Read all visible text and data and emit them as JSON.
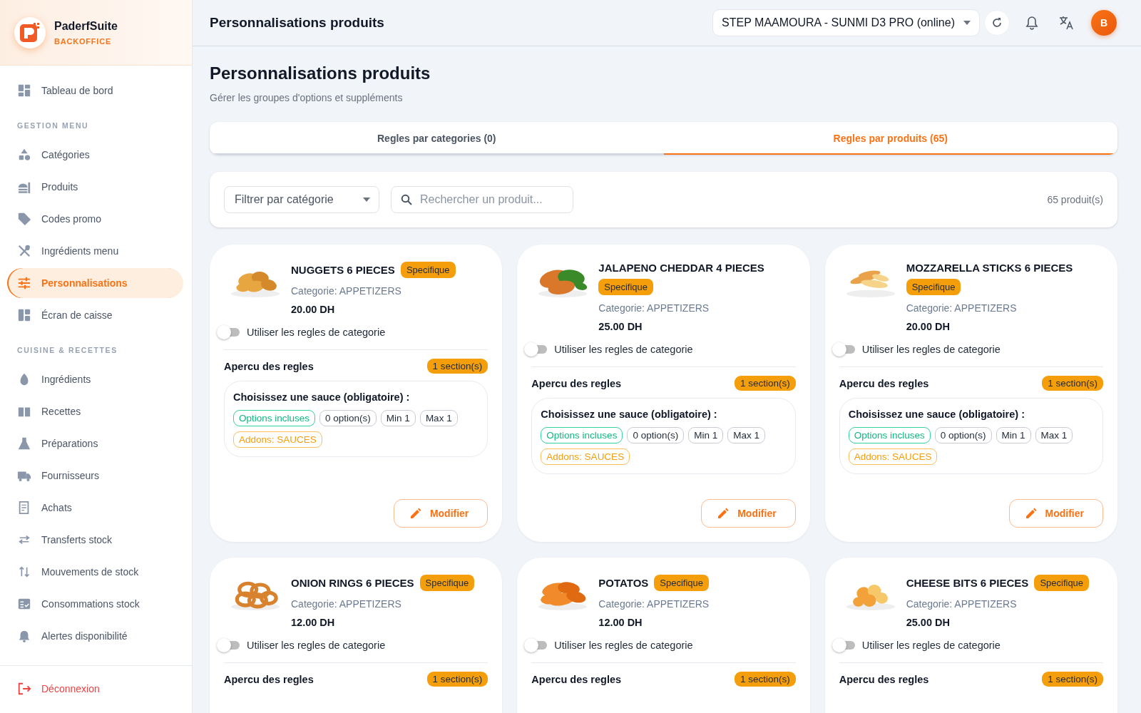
{
  "sidebar": {
    "brand": "PaderfSuite",
    "subtitle": "BACKOFFICE",
    "top_items": [
      {
        "label": "Tableau de bord",
        "selected": false
      }
    ],
    "sections": [
      {
        "title": "GESTION MENU",
        "items": [
          {
            "label": "Catégories",
            "selected": false
          },
          {
            "label": "Produits",
            "selected": false
          },
          {
            "label": "Codes promo",
            "selected": false
          },
          {
            "label": "Ingrédients menu",
            "selected": false
          },
          {
            "label": "Personnalisations",
            "selected": true
          },
          {
            "label": "Écran de caisse",
            "selected": false
          }
        ]
      },
      {
        "title": "CUISINE & RECETTES",
        "items": [
          {
            "label": "Ingrédients",
            "selected": false
          },
          {
            "label": "Recettes",
            "selected": false
          },
          {
            "label": "Préparations",
            "selected": false
          },
          {
            "label": "Fournisseurs",
            "selected": false
          },
          {
            "label": "Achats",
            "selected": false
          },
          {
            "label": "Transferts stock",
            "selected": false
          },
          {
            "label": "Mouvements de stock",
            "selected": false
          },
          {
            "label": "Consommations stock",
            "selected": false
          },
          {
            "label": "Alertes disponibilité",
            "selected": false
          }
        ]
      }
    ],
    "logout": "Déconnexion"
  },
  "header": {
    "title": "Personnalisations produits",
    "device": "STEP MAAMOURA - SUNMI D3 PRO (online)",
    "avatar": "B"
  },
  "page": {
    "title": "Personnalisations produits",
    "subtitle": "Gérer les groupes d'options et suppléments"
  },
  "tabs": [
    {
      "label": "Regles par categories (0)",
      "selected": false
    },
    {
      "label": "Regles par produits (65)",
      "selected": true
    }
  ],
  "filters": {
    "category": "Filtrer par catégorie",
    "search_placeholder": "Rechercher un produit...",
    "count": "65 produit(s)"
  },
  "products": [
    {
      "name": "NUGGETS 6 PIECES",
      "badge": "Specifique",
      "category": "Categorie: APPETIZERS",
      "price": "20.00 DH",
      "toggle_label": "Utiliser les regles de categorie",
      "use_category_rules": false,
      "rules_title": "Apercu des regles",
      "sections_count": "1 section(s)",
      "sections": [
        {
          "title": "Choisissez une sauce (obligatoire) :",
          "tags": [
            {
              "text": "Options incluses",
              "kind": "success"
            },
            {
              "text": "0 option(s)",
              "kind": "neutral"
            },
            {
              "text": "Min 1",
              "kind": "neutral"
            },
            {
              "text": "Max 1",
              "kind": "neutral"
            },
            {
              "text": "Addons: SAUCES",
              "kind": "warning"
            }
          ]
        }
      ],
      "edit": "Modifier"
    },
    {
      "name": "JALAPENO CHEDDAR 4 PIECES",
      "badge": "Specifique",
      "category": "Categorie: APPETIZERS",
      "price": "25.00 DH",
      "toggle_label": "Utiliser les regles de categorie",
      "use_category_rules": false,
      "rules_title": "Apercu des regles",
      "sections_count": "1 section(s)",
      "sections": [
        {
          "title": "Choisissez une sauce (obligatoire) :",
          "tags": [
            {
              "text": "Options incluses",
              "kind": "success"
            },
            {
              "text": "0 option(s)",
              "kind": "neutral"
            },
            {
              "text": "Min 1",
              "kind": "neutral"
            },
            {
              "text": "Max 1",
              "kind": "neutral"
            },
            {
              "text": "Addons: SAUCES",
              "kind": "warning"
            }
          ]
        }
      ],
      "edit": "Modifier"
    },
    {
      "name": "MOZZARELLA STICKS 6 PIECES",
      "badge": "Specifique",
      "category": "Categorie: APPETIZERS",
      "price": "20.00 DH",
      "toggle_label": "Utiliser les regles de categorie",
      "use_category_rules": false,
      "rules_title": "Apercu des regles",
      "sections_count": "1 section(s)",
      "sections": [
        {
          "title": "Choisissez une sauce (obligatoire) :",
          "tags": [
            {
              "text": "Options incluses",
              "kind": "success"
            },
            {
              "text": "0 option(s)",
              "kind": "neutral"
            },
            {
              "text": "Min 1",
              "kind": "neutral"
            },
            {
              "text": "Max 1",
              "kind": "neutral"
            },
            {
              "text": "Addons: SAUCES",
              "kind": "warning"
            }
          ]
        }
      ],
      "edit": "Modifier"
    },
    {
      "name": "ONION RINGS 6 PIECES",
      "badge": "Specifique",
      "category": "Categorie: APPETIZERS",
      "price": "12.00 DH",
      "toggle_label": "Utiliser les regles de categorie",
      "use_category_rules": false,
      "rules_title": "Apercu des regles",
      "sections_count": "1 section(s)"
    },
    {
      "name": "POTATOS",
      "badge": "Specifique",
      "category": "Categorie: APPETIZERS",
      "price": "12.00 DH",
      "toggle_label": "Utiliser les regles de categorie",
      "use_category_rules": false,
      "rules_title": "Apercu des regles",
      "sections_count": "1 section(s)"
    },
    {
      "name": "CHEESE BITS 6 PIECES",
      "badge": "Specifique",
      "category": "Categorie: APPETIZERS",
      "price": "25.00 DH",
      "toggle_label": "Utiliser les regles de categorie",
      "use_category_rules": false,
      "rules_title": "Apercu des regles",
      "sections_count": "1 section(s)"
    }
  ]
}
